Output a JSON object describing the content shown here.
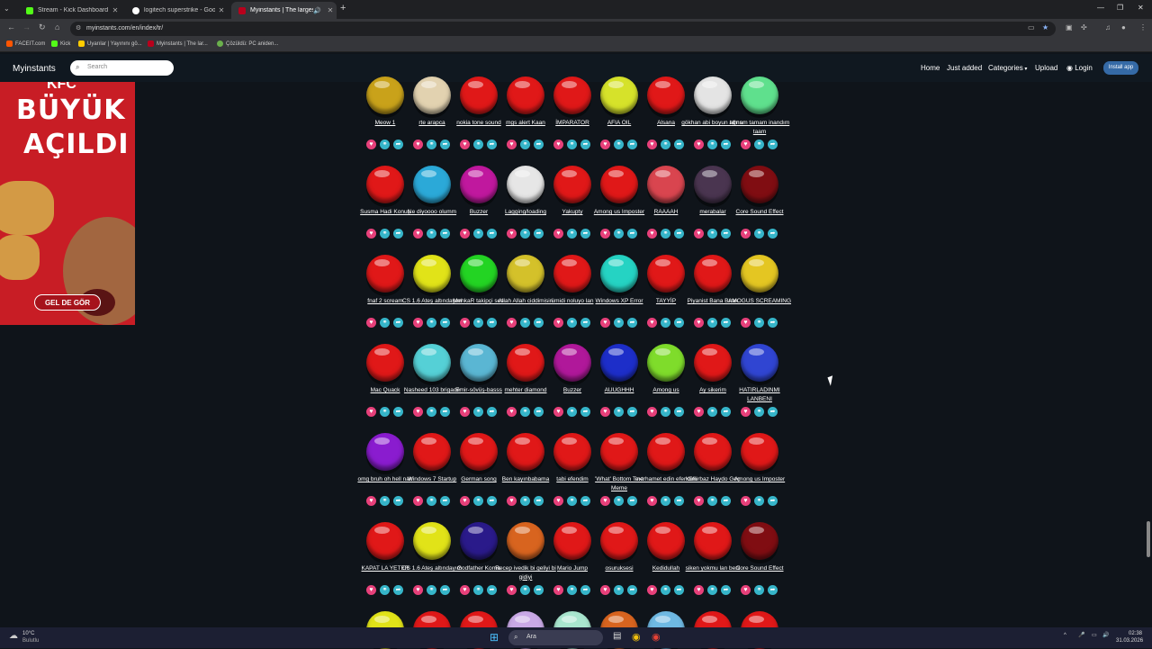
{
  "browser": {
    "tabs": [
      {
        "title": "Stream - Kick Dashboard",
        "favicon_color": "#53fc18",
        "active": false
      },
      {
        "title": "logitech superstrike - Google'd",
        "favicon_color": "#ffffff",
        "active": false
      },
      {
        "title": "Myinstants | The largest ins",
        "favicon_color": "#b8001c",
        "active": true
      }
    ],
    "new_tab": "+",
    "url": "myinstants.com/en/index/tr/",
    "bookmarks": [
      {
        "label": "FACEIT.com",
        "color": "#ff5500"
      },
      {
        "label": "Kick",
        "color": "#53fc18"
      },
      {
        "label": "Uyarılar | Yayınını gö...",
        "color": "#ffcc00"
      },
      {
        "label": "Myinstants | The lar...",
        "color": "#b8001c"
      },
      {
        "label": "Çözüldü: PC aniden...",
        "color": "#6ab04c"
      }
    ]
  },
  "site": {
    "brand": "Myinstants",
    "search_placeholder": "Search",
    "nav": {
      "home": "Home",
      "just_added": "Just added",
      "categories": "Categories",
      "upload": "Upload",
      "login": "Login",
      "install": "Install app"
    }
  },
  "ad": {
    "brand": "KFC",
    "line1": "BÜYÜK",
    "line2": "AÇILDI",
    "cta": "GEL DE GÖR"
  },
  "instants": [
    [
      {
        "label": "Meow 1",
        "color": "#c9a21a"
      },
      {
        "label": "rte arapca",
        "color": "#e2d2b0"
      },
      {
        "label": "nokia tone sound",
        "color": "#e01818"
      },
      {
        "label": "mgs alert Kaan",
        "color": "#e01818"
      },
      {
        "label": "İMPARATOR",
        "color": "#e01818"
      },
      {
        "label": "AFIA OIL",
        "color": "#d6e22a"
      },
      {
        "label": "Alsana",
        "color": "#e01818"
      },
      {
        "label": "gökhan abi boyun ağrısı",
        "color": "#e4e4e4"
      },
      {
        "label": "tamam tamam inandım taam",
        "color": "#5fe08d"
      }
    ],
    [
      {
        "label": "Susma Hadi Konuş",
        "color": "#e01818"
      },
      {
        "label": "Ne diyoooo olumm",
        "color": "#2ba9d8"
      },
      {
        "label": "Buzzer",
        "color": "#c0189e"
      },
      {
        "label": "Lagging/loading",
        "color": "#e6e6e6"
      },
      {
        "label": "Yakupty",
        "color": "#e01818"
      },
      {
        "label": "Among us Imposter",
        "color": "#e01818"
      },
      {
        "label": "RAAAAH",
        "color": "#d9454f"
      },
      {
        "label": "merabalar",
        "color": "#4a3550"
      },
      {
        "label": "Core Sound Effect",
        "color": "#800d12"
      }
    ],
    [
      {
        "label": "fnaf 2 scream",
        "color": "#e01818"
      },
      {
        "label": "CS 1.6 Ateş altındayım",
        "color": "#e1e318"
      },
      {
        "label": "MehkaR takipçi sesi",
        "color": "#23d423"
      },
      {
        "label": "Allah Allah ciddimisin",
        "color": "#d4c12a"
      },
      {
        "label": "ümidi noluyo lan",
        "color": "#e01818"
      },
      {
        "label": "Windows XP Error",
        "color": "#25d3c3"
      },
      {
        "label": "TAYYİP",
        "color": "#e01818"
      },
      {
        "label": "Piyanist Bana Bırak",
        "color": "#e01818"
      },
      {
        "label": "AMOGUS SCREAMING",
        "color": "#e4c622"
      }
    ],
    [
      {
        "label": "Mac Quack",
        "color": "#e01818"
      },
      {
        "label": "Nasheed 103 brigade",
        "color": "#55d0d6"
      },
      {
        "label": "Emir-sövüş-basss",
        "color": "#5ab6d3"
      },
      {
        "label": "mehter diamond",
        "color": "#e01818"
      },
      {
        "label": "Buzzer",
        "color": "#b0189a"
      },
      {
        "label": "AUUGHHH",
        "color": "#1d2ec9"
      },
      {
        "label": "Among us",
        "color": "#7fdc2b"
      },
      {
        "label": "Ay sikerim",
        "color": "#e01818"
      },
      {
        "label": "HATIRLADINMI LANBENI",
        "color": "#3045d2"
      }
    ],
    [
      {
        "label": "omg bruh oh hell nah",
        "color": "#8a1ccf"
      },
      {
        "label": "Windows 7 Startup",
        "color": "#e01818"
      },
      {
        "label": "German song",
        "color": "#e01818"
      },
      {
        "label": "Ben kayınbabama",
        "color": "#e01818"
      },
      {
        "label": "tabi efendim",
        "color": "#e01818"
      },
      {
        "label": "'What' Bottom Text Meme",
        "color": "#e01818"
      },
      {
        "label": "merhamet edin efendim",
        "color": "#e01818"
      },
      {
        "label": "Küfürbaz Haydo Geç",
        "color": "#e01818"
      },
      {
        "label": "Among us Imposter",
        "color": "#e01818"
      }
    ],
    [
      {
        "label": "KAPAT LA YETER",
        "color": "#e01818"
      },
      {
        "label": "CS 1.6 Ateş altındayım",
        "color": "#e1e318"
      },
      {
        "label": "Godfather Korna",
        "color": "#2a1a8a"
      },
      {
        "label": "Recep ivedik bi geliyi bi gidiyi",
        "color": "#d8641f"
      },
      {
        "label": "Mario Jump",
        "color": "#e01818"
      },
      {
        "label": "osuruksesi",
        "color": "#e01818"
      },
      {
        "label": "Kedidullah",
        "color": "#e01818"
      },
      {
        "label": "siken yokmu lan beni",
        "color": "#e01818"
      },
      {
        "label": "Core Sound Effect",
        "color": "#800d12"
      }
    ],
    [
      {
        "label": "",
        "color": "#e1e318"
      },
      {
        "label": "",
        "color": "#e01818"
      },
      {
        "label": "",
        "color": "#e01818"
      },
      {
        "label": "",
        "color": "#c9a9e6"
      },
      {
        "label": "",
        "color": "#a9e6cf"
      },
      {
        "label": "",
        "color": "#d8641f"
      },
      {
        "label": "",
        "color": "#6fb9e3"
      },
      {
        "label": "",
        "color": "#e01818"
      },
      {
        "label": "",
        "color": "#e01818"
      }
    ]
  ],
  "taskbar": {
    "weather_temp": "10°C",
    "weather_desc": "Bulutlu",
    "search": "Ara",
    "time": "02:38",
    "date": "31.03.2026"
  }
}
